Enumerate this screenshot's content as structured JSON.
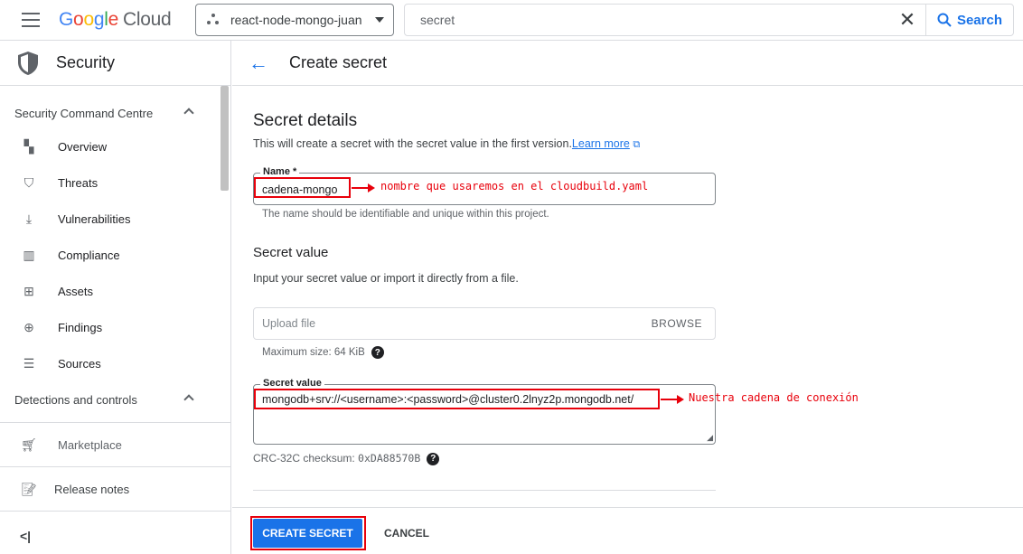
{
  "topbar": {
    "logo": {
      "g1": "G",
      "g2": "o",
      "g3": "o",
      "g4": "g",
      "g5": "l",
      "g6": "e",
      "cloud": "Cloud"
    },
    "project": "react-node-mongo-juan",
    "search_value": "secret",
    "search_button": "Search"
  },
  "sidebar": {
    "title": "Security",
    "section1": "Security Command Centre",
    "items": [
      {
        "label": "Overview",
        "icon": "overview-icon"
      },
      {
        "label": "Threats",
        "icon": "shield-icon"
      },
      {
        "label": "Vulnerabilities",
        "icon": "download-icon"
      },
      {
        "label": "Compliance",
        "icon": "bar-chart-icon"
      },
      {
        "label": "Assets",
        "icon": "hierarchy-icon"
      },
      {
        "label": "Findings",
        "icon": "globe-search-icon"
      },
      {
        "label": "Sources",
        "icon": "list-icon"
      }
    ],
    "section2": "Detections and controls",
    "marketplace": "Marketplace",
    "release_notes": "Release notes",
    "collapse": "<|"
  },
  "header": {
    "title": "Create secret"
  },
  "form": {
    "heading": "Secret details",
    "description": "This will create a secret with the secret value in the first version.",
    "learn_more": "Learn more",
    "name_label": "Name *",
    "name_value": "cadena-mongo",
    "name_hint": "The name should be identifiable and unique within this project.",
    "value_heading": "Secret value",
    "value_description": "Input your secret value or import it directly from a file.",
    "upload_placeholder": "Upload file",
    "browse": "BROWSE",
    "max_size": "Maximum size: 64 KiB",
    "secret_value_label": "Secret value",
    "secret_value": "mongodb+srv://<username>:<password>@cluster0.2lnyz2p.mongodb.net/",
    "checksum_label": "CRC-32C checksum:",
    "checksum_value": "0xDA88570B"
  },
  "annotations": {
    "name_note": "nombre que usaremos en el cloudbuild.yaml",
    "value_note": "Nuestra cadena de conexión"
  },
  "footer": {
    "create": "CREATE SECRET",
    "cancel": "CANCEL"
  },
  "colors": {
    "accent": "#1a73e8",
    "annotation": "#e8000b"
  }
}
